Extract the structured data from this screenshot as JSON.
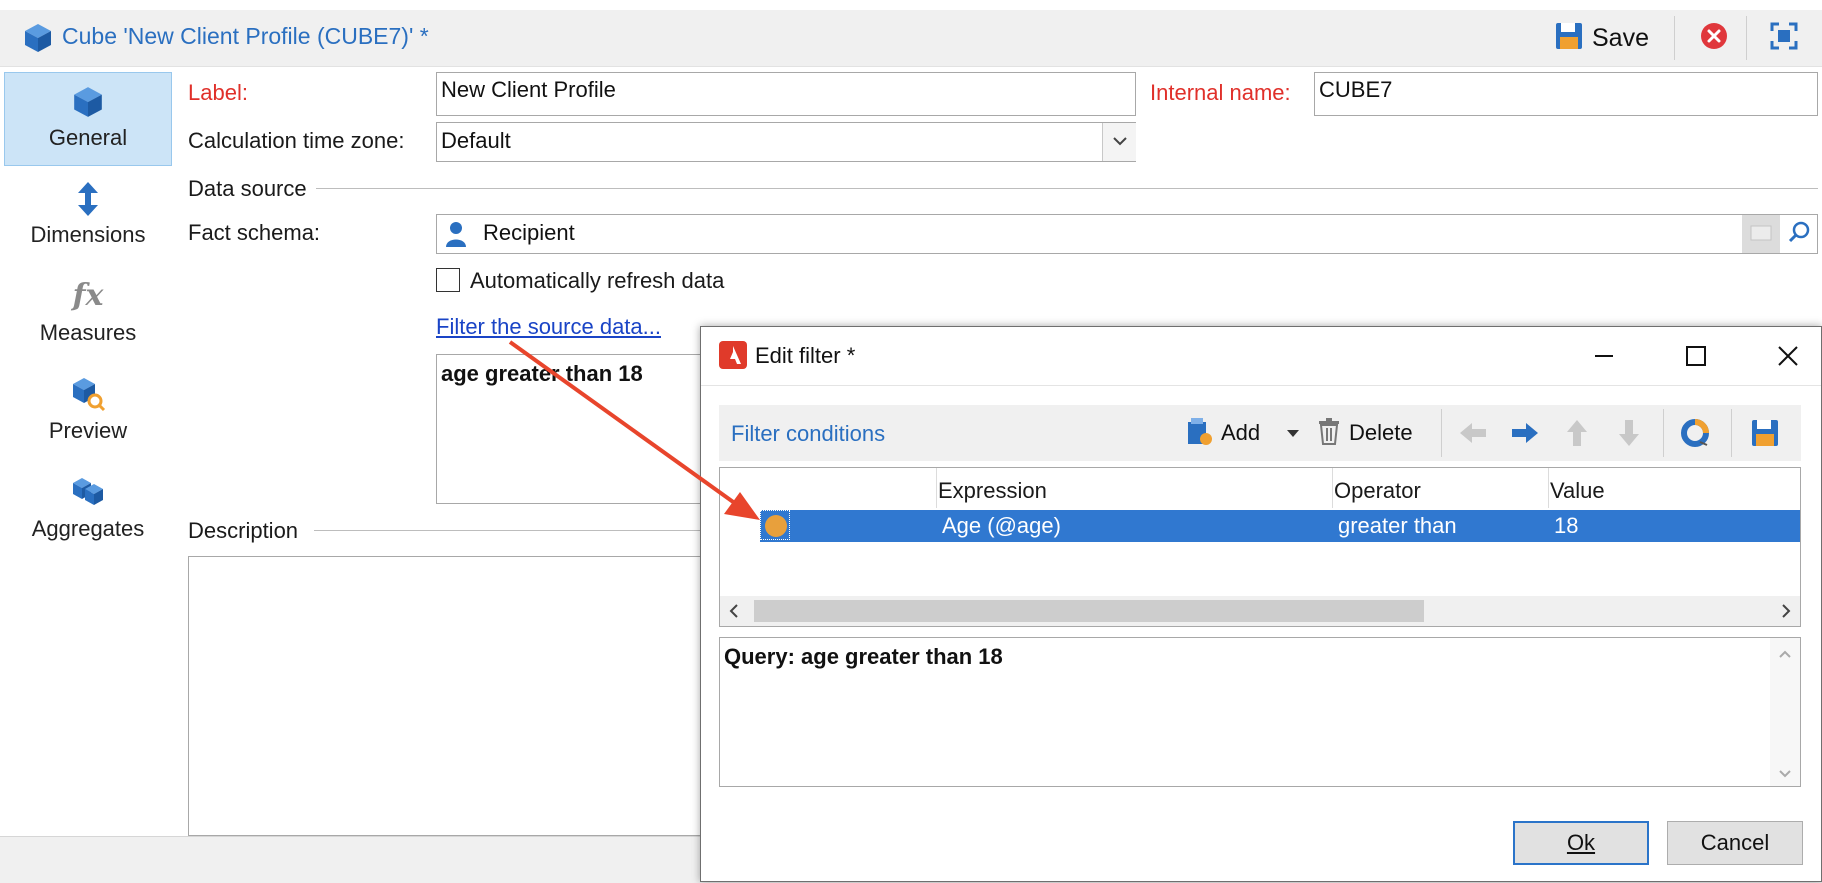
{
  "window": {
    "title": "Cube 'New Client Profile (CUBE7)' *",
    "save_label": "Save"
  },
  "nav": [
    {
      "label": "General",
      "icon": "cube-icon",
      "selected": true
    },
    {
      "label": "Dimensions",
      "icon": "up-down-arrow-icon"
    },
    {
      "label": "Measures",
      "icon": "fx-icon"
    },
    {
      "label": "Preview",
      "icon": "cube-search-icon"
    },
    {
      "label": "Aggregates",
      "icon": "cubes-icon"
    }
  ],
  "form": {
    "label_caption": "Label:",
    "label_value": "New Client Profile",
    "internal_caption": "Internal name:",
    "internal_value": "CUBE7",
    "timezone_caption": "Calculation time zone:",
    "timezone_value": "Default",
    "datasource_caption": "Data source",
    "fact_caption": "Fact schema:",
    "fact_value": "Recipient",
    "autorefresh_label": "Automatically refresh data",
    "autorefresh_checked": false,
    "filter_link": "Filter the source data...",
    "filter_summary": "age greater than 18",
    "description_caption": "Description"
  },
  "dialog": {
    "title": "Edit filter *",
    "section_title": "Filter conditions",
    "add_label": "Add",
    "delete_label": "Delete",
    "columns": [
      "Expression",
      "Operator",
      "Value"
    ],
    "rows": [
      {
        "expression": "Age (@age)",
        "operator": "greater than",
        "value": "18"
      }
    ],
    "query_text": "Query: age greater than 18",
    "ok_label": "Ok",
    "cancel_label": "Cancel"
  },
  "colors": {
    "accent": "#2a6fc0",
    "selection": "#3078d0",
    "required": "#e0302a",
    "arrow": "#e8452c"
  }
}
